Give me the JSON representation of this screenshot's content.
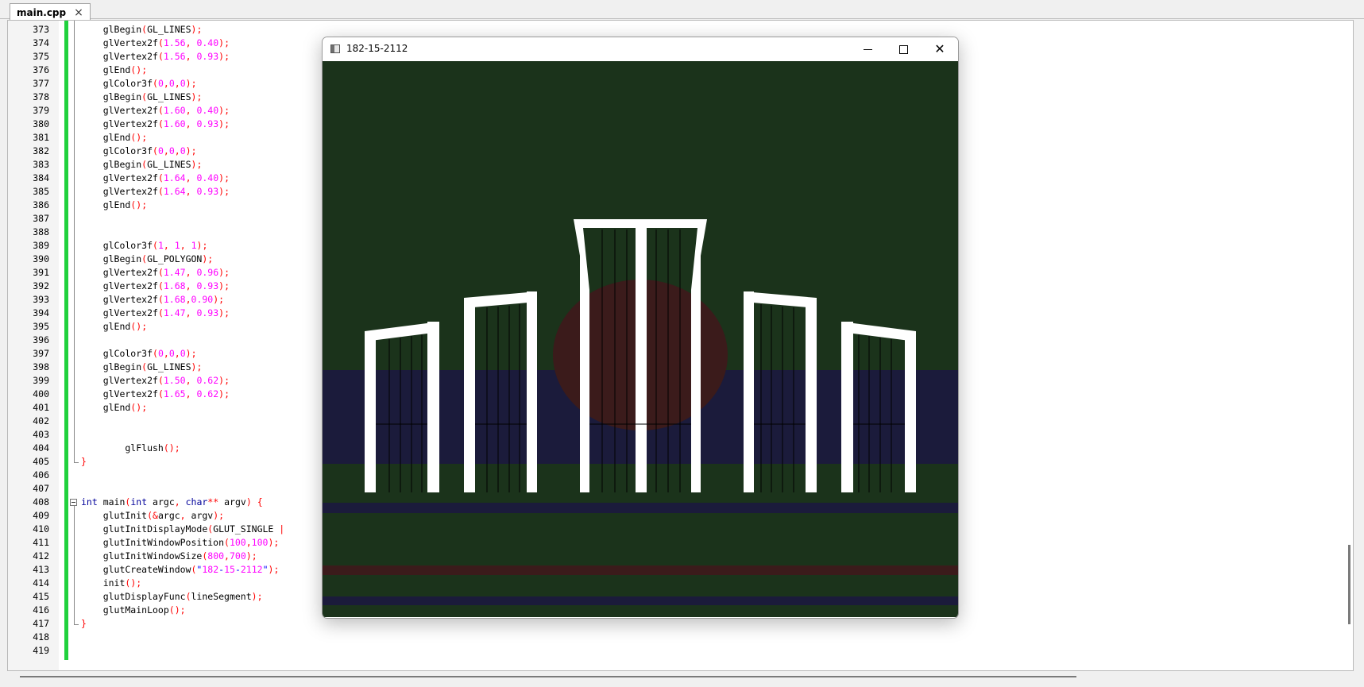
{
  "editor": {
    "tab_label": "main.cpp",
    "lines": [
      {
        "n": "373",
        "t": "    glBegin(GL_LINES);"
      },
      {
        "n": "374",
        "t": "    glVertex2f(1.56, 0.40);"
      },
      {
        "n": "375",
        "t": "    glVertex2f(1.56, 0.93);"
      },
      {
        "n": "376",
        "t": "    glEnd();"
      },
      {
        "n": "377",
        "t": "    glColor3f(0,0,0);"
      },
      {
        "n": "378",
        "t": "    glBegin(GL_LINES);"
      },
      {
        "n": "379",
        "t": "    glVertex2f(1.60, 0.40);"
      },
      {
        "n": "380",
        "t": "    glVertex2f(1.60, 0.93);"
      },
      {
        "n": "381",
        "t": "    glEnd();"
      },
      {
        "n": "382",
        "t": "    glColor3f(0,0,0);"
      },
      {
        "n": "383",
        "t": "    glBegin(GL_LINES);"
      },
      {
        "n": "384",
        "t": "    glVertex2f(1.64, 0.40);"
      },
      {
        "n": "385",
        "t": "    glVertex2f(1.64, 0.93);"
      },
      {
        "n": "386",
        "t": "    glEnd();"
      },
      {
        "n": "387",
        "t": ""
      },
      {
        "n": "388",
        "t": ""
      },
      {
        "n": "389",
        "t": "    glColor3f(1, 1, 1);"
      },
      {
        "n": "390",
        "t": "    glBegin(GL_POLYGON);"
      },
      {
        "n": "391",
        "t": "    glVertex2f(1.47, 0.96);"
      },
      {
        "n": "392",
        "t": "    glVertex2f(1.68, 0.93);"
      },
      {
        "n": "393",
        "t": "    glVertex2f(1.68,0.90);"
      },
      {
        "n": "394",
        "t": "    glVertex2f(1.47, 0.93);"
      },
      {
        "n": "395",
        "t": "    glEnd();"
      },
      {
        "n": "396",
        "t": ""
      },
      {
        "n": "397",
        "t": "    glColor3f(0,0,0);"
      },
      {
        "n": "398",
        "t": "    glBegin(GL_LINES);"
      },
      {
        "n": "399",
        "t": "    glVertex2f(1.50, 0.62);"
      },
      {
        "n": "400",
        "t": "    glVertex2f(1.65, 0.62);"
      },
      {
        "n": "401",
        "t": "    glEnd();"
      },
      {
        "n": "402",
        "t": ""
      },
      {
        "n": "403",
        "t": ""
      },
      {
        "n": "404",
        "t": "        glFlush();"
      },
      {
        "n": "405",
        "t": "}"
      },
      {
        "n": "406",
        "t": ""
      },
      {
        "n": "407",
        "t": ""
      },
      {
        "n": "408",
        "t": "int main(int argc, char** argv) {"
      },
      {
        "n": "409",
        "t": "    glutInit(&argc, argv);"
      },
      {
        "n": "410",
        "t": "    glutInitDisplayMode(GLUT_SINGLE |"
      },
      {
        "n": "411",
        "t": "    glutInitWindowPosition(100,100);"
      },
      {
        "n": "412",
        "t": "    glutInitWindowSize(800,700);"
      },
      {
        "n": "413",
        "t": "    glutCreateWindow(\"182-15-2112\");"
      },
      {
        "n": "414",
        "t": "    init();"
      },
      {
        "n": "415",
        "t": "    glutDisplayFunc(lineSegment);"
      },
      {
        "n": "416",
        "t": "    glutMainLoop();"
      },
      {
        "n": "417",
        "t": "}"
      },
      {
        "n": "418",
        "t": ""
      },
      {
        "n": "419",
        "t": ""
      }
    ]
  },
  "gl_window": {
    "title": "182-15-2112",
    "minimize_glyph": "",
    "close_glyph": "✕"
  },
  "colors": {
    "scene_green": "#1b331b",
    "navy_band": "#1b1b3b",
    "sun_red": "#3b1b1b",
    "monument_white": "#ffffff",
    "change_bar": "#20d13d"
  }
}
